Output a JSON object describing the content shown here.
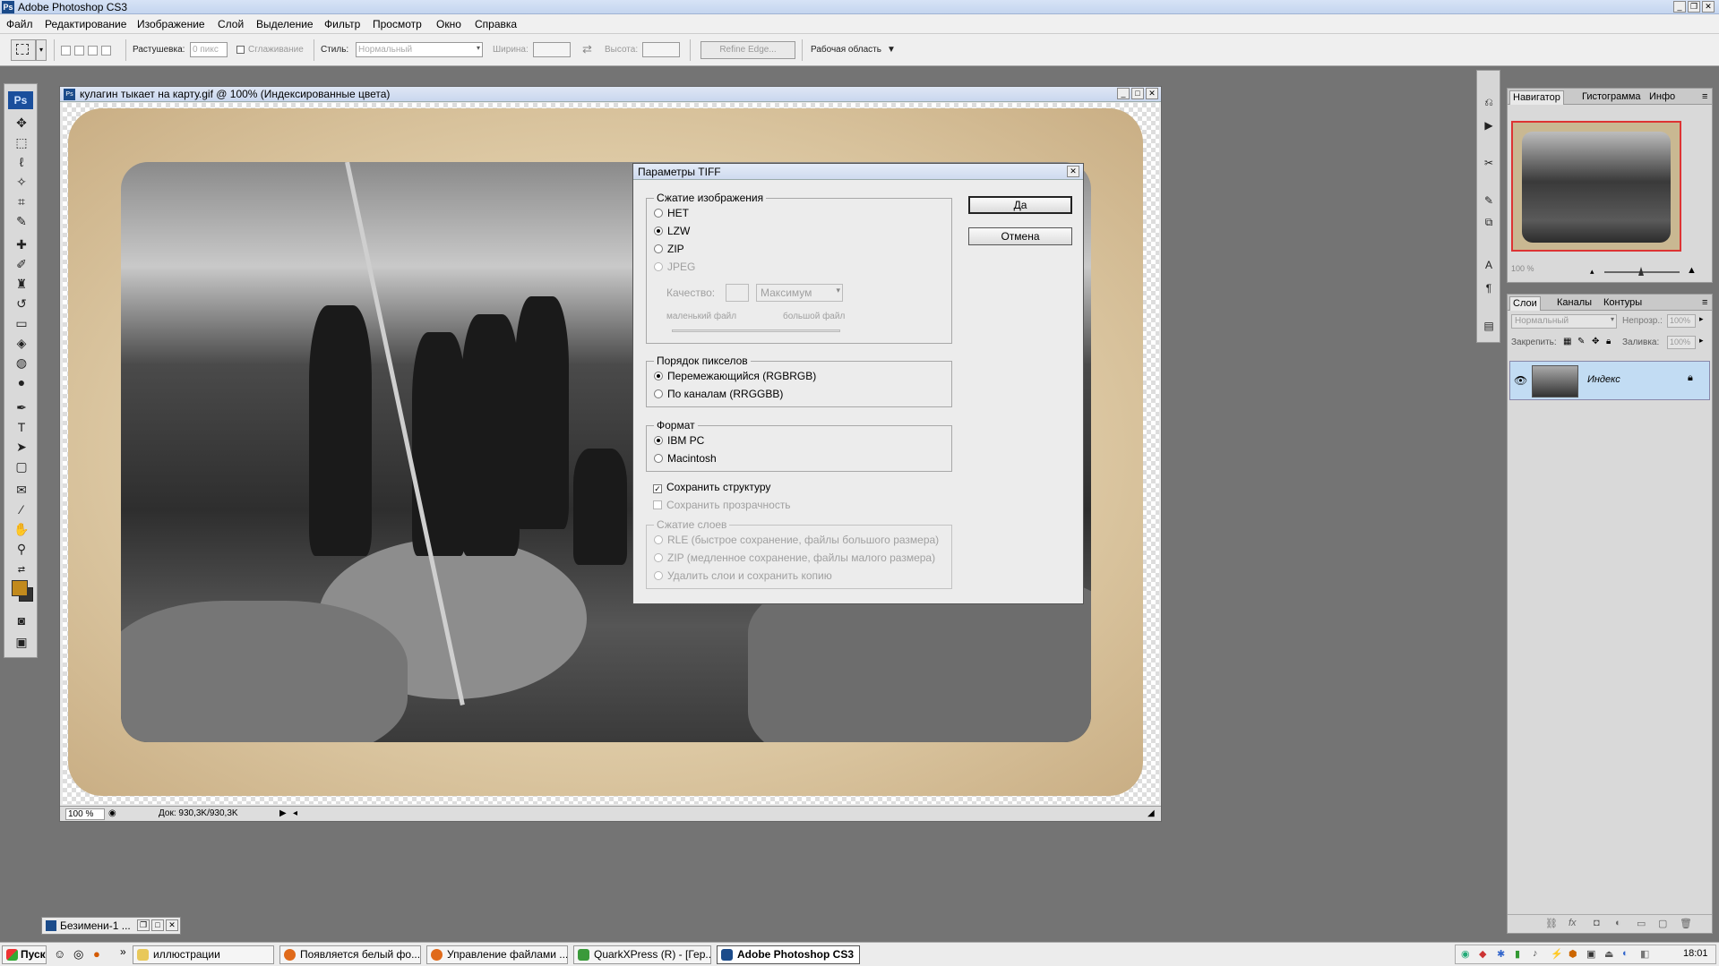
{
  "app": {
    "title": "Adobe Photoshop CS3",
    "menu": [
      "Файл",
      "Редактирование",
      "Изображение",
      "Слой",
      "Выделение",
      "Фильтр",
      "Просмотр",
      "Окно",
      "Справка"
    ]
  },
  "options": {
    "feather_label": "Растушевка:",
    "feather_value": "0 пикс",
    "antialias_label": "Сглаживание",
    "style_label": "Стиль:",
    "style_value": "Нормальный",
    "width_label": "Ширина:",
    "height_label": "Высота:",
    "refine_edge": "Refine Edge...",
    "workspace": "Рабочая область"
  },
  "document": {
    "title": "кулагин тыкает на карту.gif @ 100% (Индексированные цвета)",
    "zoom": "100 %",
    "doc_info": "Док: 930,3K/930,3K"
  },
  "dialog": {
    "title": "Параметры TIFF",
    "ok": "Да",
    "cancel": "Отмена",
    "compression": {
      "legend": "Сжатие изображения",
      "options": [
        "НЕТ",
        "LZW",
        "ZIP",
        "JPEG"
      ],
      "selected": "LZW",
      "quality_label": "Качество:",
      "quality_preset": "Максимум",
      "small_file": "маленький файл",
      "large_file": "большой файл"
    },
    "pixel_order": {
      "legend": "Порядок пикселов",
      "options": [
        "Перемежающийся (RGBRGB)",
        "По каналам (RRGGBB)"
      ],
      "selected": "Перемежающийся (RGBRGB)"
    },
    "byte_order": {
      "legend": "Формат",
      "options": [
        "IBM PC",
        "Macintosh"
      ],
      "selected": "IBM PC"
    },
    "save_pyramid": "Сохранить структуру",
    "save_transparency": "Сохранить прозрачность",
    "layer_compression": {
      "legend": "Сжатие слоев",
      "options": [
        "RLE (быстрое сохранение, файлы большого размера)",
        "ZIP (медленное сохранение, файлы малого размера)",
        "Удалить слои и сохранить копию"
      ]
    }
  },
  "panels": {
    "nav_tabs": [
      "Навигатор",
      "Гистограмма",
      "Инфо"
    ],
    "nav_zoom": "100 %",
    "layer_tabs": [
      "Слои",
      "Каналы",
      "Контуры"
    ],
    "blend_mode": "Нормальный",
    "opacity_label": "Непрозр.:",
    "opacity_value": "100%",
    "lock_label": "Закрепить:",
    "fill_label": "Заливка:",
    "fill_value": "100%",
    "layer_name": "Индекс"
  },
  "minidoc": {
    "title": "Безимени-1 ..."
  },
  "taskbar": {
    "start": "Пуск",
    "tasks": [
      "иллюстрации",
      "Появляется белый фо...",
      "Управление файлами ...",
      "QuarkXPress (R) - [Гер...",
      "Adobe Photoshop CS3"
    ],
    "clock": "18:01"
  },
  "colors": {
    "foreground": "#c28a1d",
    "background": "#333333",
    "selection_highlight": "#c2dcf3"
  }
}
